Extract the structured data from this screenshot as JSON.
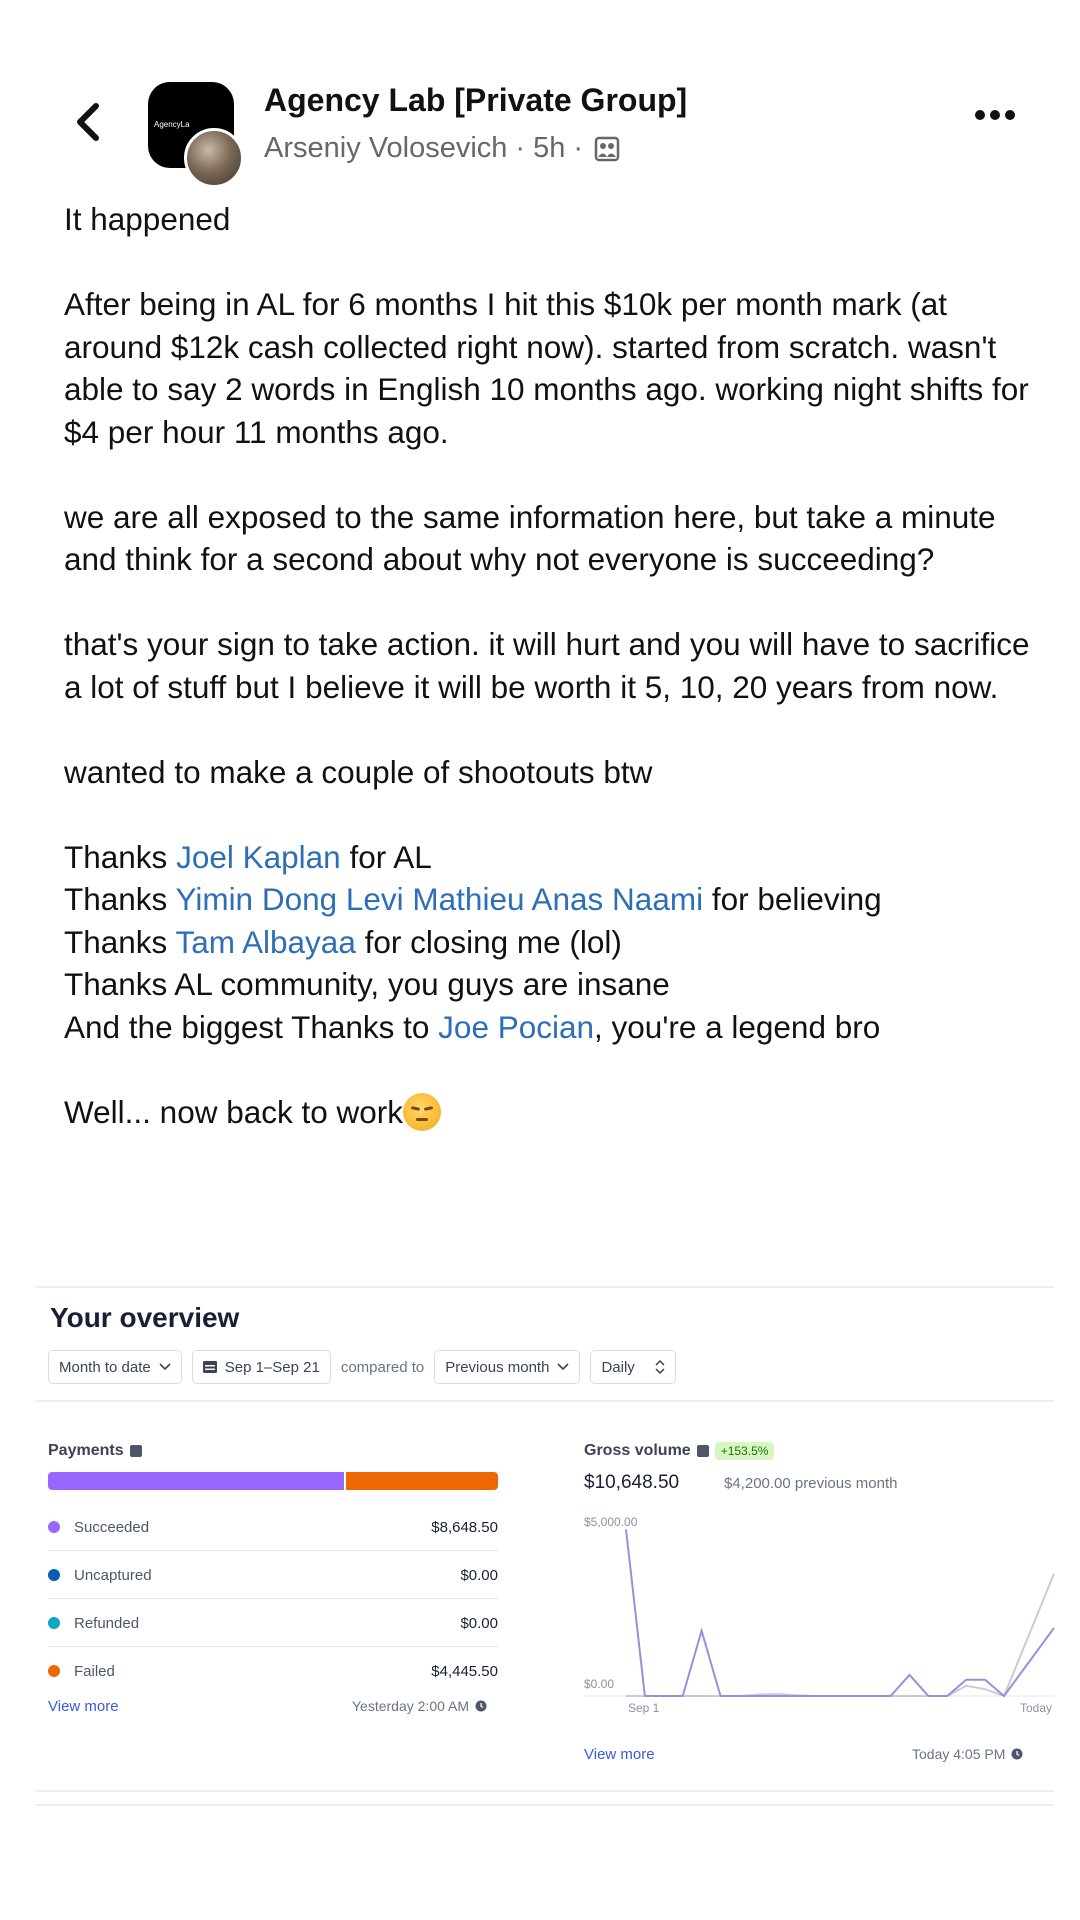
{
  "header": {
    "group_name": "Agency Lab [Private Group]",
    "author": "Arseniy Volosevich",
    "time": "5h",
    "separator": "·",
    "avatar_text": "AgencyLa"
  },
  "post": {
    "p1": "It happened",
    "p2": "After being in AL for 6 months I hit this $10k per month mark (at around $12k cash collected right now). started from scratch. wasn't able to say 2 words in English 10 months ago. working night shifts for $4 per hour 11 months ago.",
    "p3": "we are all exposed to the same information here, but take a minute and think for a second about why not everyone is succeeding?",
    "p4": "that's your sign to take action. it will hurt and you will have to sacrifice a lot of stuff but I believe it will be worth it 5, 10, 20 years from now.",
    "p5": "wanted to make a couple of shootouts btw",
    "thanks": [
      {
        "before": "Thanks ",
        "mention": "Joel Kaplan",
        "after": " for AL"
      },
      {
        "before": "Thanks ",
        "mention": "Yimin Dong Levi Mathieu Anas Naami",
        "after": " for believing"
      },
      {
        "before": "Thanks ",
        "mention": "Tam Albayaa",
        "after": " for closing me (lol)"
      },
      {
        "before": "Thanks AL community, you guys are insane",
        "mention": "",
        "after": ""
      },
      {
        "before": "And the biggest Thanks to ",
        "mention": "Joe Pocian",
        "after": ", you're a legend bro"
      }
    ],
    "closing": "Well... now back to work",
    "closing_emoji": "unamused-face-icon"
  },
  "overview": {
    "title": "Your overview",
    "range_label": "Month to date",
    "date_range": "Sep 1–Sep 21",
    "compared_to": "compared to",
    "compare_label": "Previous month",
    "interval_label": "Daily",
    "payments": {
      "title": "Payments",
      "rows": [
        {
          "label": "Succeeded",
          "value": "$8,648.50",
          "color": "#9966ff"
        },
        {
          "label": "Uncaptured",
          "value": "$0.00",
          "color": "#0a5bb5"
        },
        {
          "label": "Refunded",
          "value": "$0.00",
          "color": "#0fa5c4"
        },
        {
          "label": "Failed",
          "value": "$4,445.50",
          "color": "#ed6804"
        }
      ],
      "bar_fractions": {
        "succeeded": 0.6605,
        "failed": 0.3395
      },
      "view_more": "View more",
      "updated": "Yesterday 2:00 AM"
    },
    "gross_volume": {
      "title": "Gross volume",
      "change": "+153.5%",
      "total": "$10,648.50",
      "previous": "$4,200.00 previous month",
      "view_more": "View more",
      "updated": "Today 4:05 PM"
    }
  },
  "chart_data": {
    "type": "line",
    "x_tick_labels": [
      "Sep 1",
      "Today"
    ],
    "y_tick_labels": [
      "$5,000.00",
      "$0.00"
    ],
    "ylim": [
      0,
      5000
    ],
    "x": [
      1,
      2,
      3,
      4,
      5,
      6,
      7,
      8,
      9,
      10,
      11,
      12,
      13,
      14,
      15,
      16,
      17,
      18,
      19,
      20,
      21
    ],
    "series": [
      {
        "values": [
          4900,
          0,
          0,
          0,
          1920,
          0,
          0,
          0,
          0,
          0,
          0,
          0,
          0,
          0,
          0,
          620,
          0,
          0,
          480,
          480,
          0
        ],
        "end_value": 2000,
        "color": "#9a8fdc"
      },
      {
        "values": [
          0,
          0,
          0,
          0,
          0,
          0,
          0,
          40,
          60,
          20,
          0,
          0,
          0,
          0,
          0,
          0,
          0,
          0,
          300,
          200,
          0
        ],
        "end_value": 3600,
        "color": "#c9ccd6"
      }
    ],
    "grid": false,
    "legend": "none"
  }
}
